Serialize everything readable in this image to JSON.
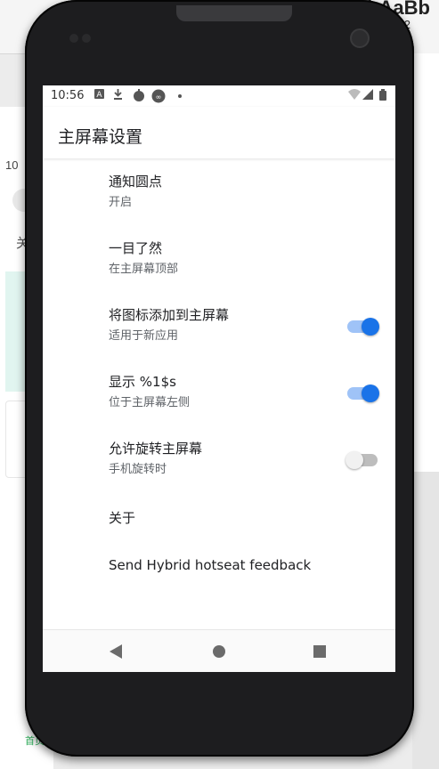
{
  "background": {
    "toolbar_text": "AaBbAaBb",
    "toolbar_num": "2",
    "time": "10",
    "char": "关",
    "home_label": "首页"
  },
  "statusbar": {
    "time": "10:56"
  },
  "appbar": {
    "title": "主屏幕设置"
  },
  "preferences": [
    {
      "title": "通知圆点",
      "summary": "开启"
    },
    {
      "title": "一目了然",
      "summary": "在主屏幕顶部"
    },
    {
      "title": "将图标添加到主屏幕",
      "summary": "适用于新应用",
      "switch": "on"
    },
    {
      "title": "显示 %1$s",
      "summary": "位于主屏幕左侧",
      "switch": "on"
    },
    {
      "title": "允许旋转主屏幕",
      "summary": "手机旋转时",
      "switch": "off"
    },
    {
      "title": "关于"
    },
    {
      "title": "Send Hybrid hotseat feedback"
    }
  ],
  "colors": {
    "switch_on": "#1a73e8",
    "switch_track_on": "#9fc3f7",
    "switch_off": "#f1f1f1"
  }
}
